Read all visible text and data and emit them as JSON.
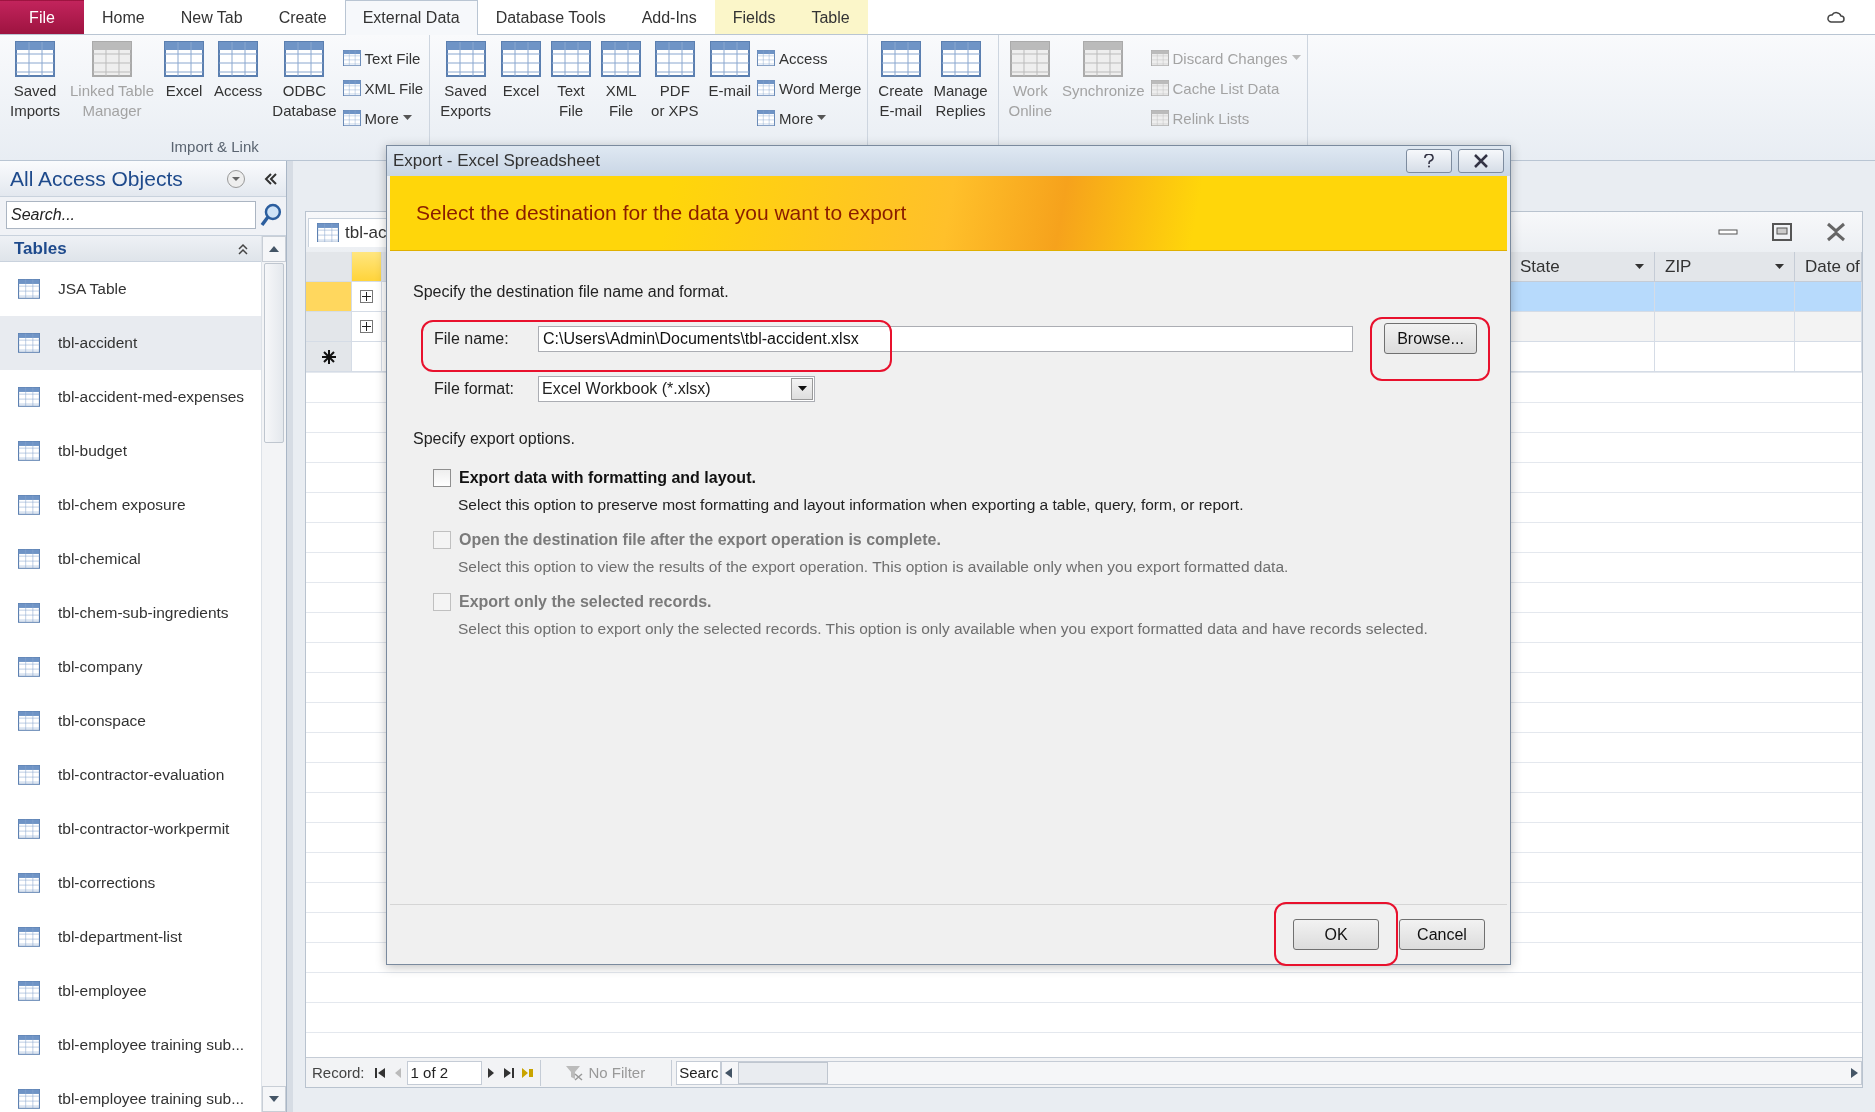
{
  "ribbon_tabs": [
    {
      "label": "File",
      "kind": "file",
      "selected": false
    },
    {
      "label": "Home",
      "kind": "normal",
      "selected": false
    },
    {
      "label": "New Tab",
      "kind": "normal",
      "selected": false
    },
    {
      "label": "Create",
      "kind": "normal",
      "selected": false
    },
    {
      "label": "External Data",
      "kind": "normal",
      "selected": true
    },
    {
      "label": "Database Tools",
      "kind": "normal",
      "selected": false
    },
    {
      "label": "Add-Ins",
      "kind": "normal",
      "selected": false
    },
    {
      "label": "Fields",
      "kind": "context",
      "selected": false
    },
    {
      "label": "Table",
      "kind": "context",
      "selected": false
    }
  ],
  "ribbon_groups": [
    {
      "label": "Import & Link",
      "large": [
        {
          "label": "Saved\nImports",
          "disabled": false
        },
        {
          "label": "Linked Table\nManager",
          "disabled": true
        },
        {
          "label": "Excel",
          "disabled": false
        },
        {
          "label": "Access",
          "disabled": false
        },
        {
          "label": "ODBC\nDatabase",
          "disabled": false
        }
      ],
      "small": [
        {
          "label": "Text File",
          "disabled": false,
          "menu": false
        },
        {
          "label": "XML File",
          "disabled": false,
          "menu": false
        },
        {
          "label": "More",
          "disabled": false,
          "menu": true
        }
      ]
    },
    {
      "large": [
        {
          "label": "Saved\nExports",
          "disabled": false
        },
        {
          "label": "Excel",
          "disabled": false
        },
        {
          "label": "Text\nFile",
          "disabled": false
        },
        {
          "label": "XML\nFile",
          "disabled": false
        },
        {
          "label": "PDF\nor XPS",
          "disabled": false
        },
        {
          "label": "E-mail",
          "disabled": false
        }
      ],
      "small": [
        {
          "label": "Access",
          "disabled": false,
          "menu": false
        },
        {
          "label": "Word Merge",
          "disabled": false,
          "menu": false
        },
        {
          "label": "More",
          "disabled": false,
          "menu": true
        }
      ]
    },
    {
      "large": [
        {
          "label": "Create\nE-mail",
          "disabled": false
        },
        {
          "label": "Manage\nReplies",
          "disabled": false
        }
      ]
    },
    {
      "large": [
        {
          "label": "Work\nOnline",
          "disabled": true
        },
        {
          "label": "Synchronize",
          "disabled": true
        }
      ],
      "small": [
        {
          "label": "Discard Changes",
          "disabled": true,
          "menu": true
        },
        {
          "label": "Cache List Data",
          "disabled": true,
          "menu": false
        },
        {
          "label": "Relink Lists",
          "disabled": true,
          "menu": false
        }
      ]
    }
  ],
  "nav_pane": {
    "title": "All Access Objects",
    "search": {
      "placeholder": "Search..."
    },
    "section": "Tables",
    "items": [
      {
        "label": "JSA Table",
        "selected": false
      },
      {
        "label": "tbl-accident",
        "selected": true
      },
      {
        "label": "tbl-accident-med-expenses",
        "selected": false
      },
      {
        "label": "tbl-budget",
        "selected": false
      },
      {
        "label": "tbl-chem exposure",
        "selected": false
      },
      {
        "label": "tbl-chemical",
        "selected": false
      },
      {
        "label": "tbl-chem-sub-ingredients",
        "selected": false
      },
      {
        "label": "tbl-company",
        "selected": false
      },
      {
        "label": "tbl-conspace",
        "selected": false
      },
      {
        "label": "tbl-contractor-evaluation",
        "selected": false
      },
      {
        "label": "tbl-contractor-workpermit",
        "selected": false
      },
      {
        "label": "tbl-corrections",
        "selected": false
      },
      {
        "label": "tbl-department-list",
        "selected": false
      },
      {
        "label": "tbl-employee",
        "selected": false
      },
      {
        "label": "tbl-employee training sub...",
        "selected": false
      },
      {
        "label": "tbl-employee training sub...",
        "selected": false
      }
    ]
  },
  "datasheet": {
    "title": "tbl-ac",
    "columns": [
      "State",
      "ZIP",
      "Date of"
    ],
    "rows": [
      {
        "selected": true
      },
      {
        "selected": false
      }
    ],
    "status_bar": {
      "record_label": "Record:",
      "position": "1 of 2",
      "filter": "No Filter",
      "search": "Searc"
    }
  },
  "dialog": {
    "title": "Export - Excel Spreadsheet",
    "banner": "Select the destination for the data you want to export",
    "intro": "Specify the destination file name and format.",
    "file_name": {
      "label": "File name:",
      "value": "C:\\Users\\Admin\\Documents\\tbl-accident.xlsx",
      "highlighted": true
    },
    "browse": {
      "label": "Browse...",
      "highlighted": true
    },
    "file_format": {
      "label": "File format:",
      "value": "Excel Workbook (*.xlsx)"
    },
    "options_heading": "Specify export options.",
    "options": [
      {
        "label": "Export data with formatting and layout.",
        "description": "Select this option to preserve most formatting and layout information when exporting a table, query, form, or report.",
        "checked": false,
        "disabled": false
      },
      {
        "label": "Open the destination file after the export operation is complete.",
        "description": "Select this option to view the results of the export operation. This option is available only when you export formatted data.",
        "checked": false,
        "disabled": true
      },
      {
        "label": "Export only the selected records.",
        "description": "Select this option to export only the selected records. This option is only available when you export formatted data and have records selected.",
        "checked": false,
        "disabled": true
      }
    ],
    "buttons": [
      {
        "label": "OK",
        "highlighted": true
      },
      {
        "label": "Cancel"
      }
    ]
  }
}
